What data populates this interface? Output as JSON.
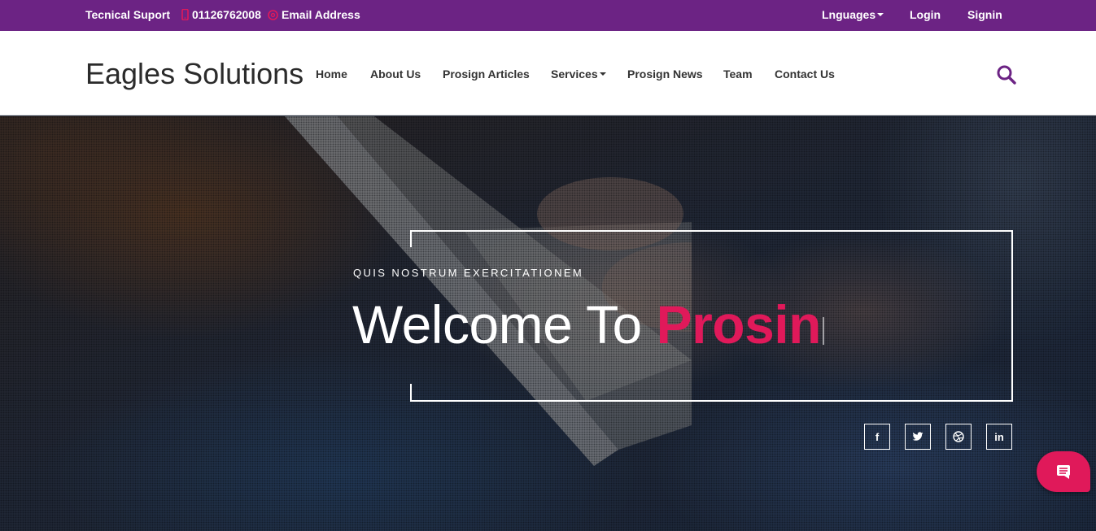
{
  "topbar": {
    "support_label": "Tecnical Suport",
    "phone": "01126762008",
    "email": "Email Address",
    "languages_label": "Lnguages",
    "login_label": "Login",
    "signin_label": "Signin"
  },
  "header": {
    "brand": "Eagles Solutions",
    "nav": [
      "Home",
      "About Us",
      "Prosign Articles",
      "Services",
      "Prosign News",
      "Team",
      "Contact Us"
    ]
  },
  "hero": {
    "kicker": "QUIS NOSTRUM EXERCITATIONEM",
    "headline_plain": "Welcome To",
    "headline_accent": "Prosin"
  },
  "social": {
    "facebook": "f",
    "twitter_icon": "twitter-icon",
    "dribbble_icon": "dribbble-icon",
    "linkedin": "in"
  },
  "colors": {
    "topbar": "#6c2384",
    "accent": "#e0195a",
    "search": "#6c2384"
  }
}
